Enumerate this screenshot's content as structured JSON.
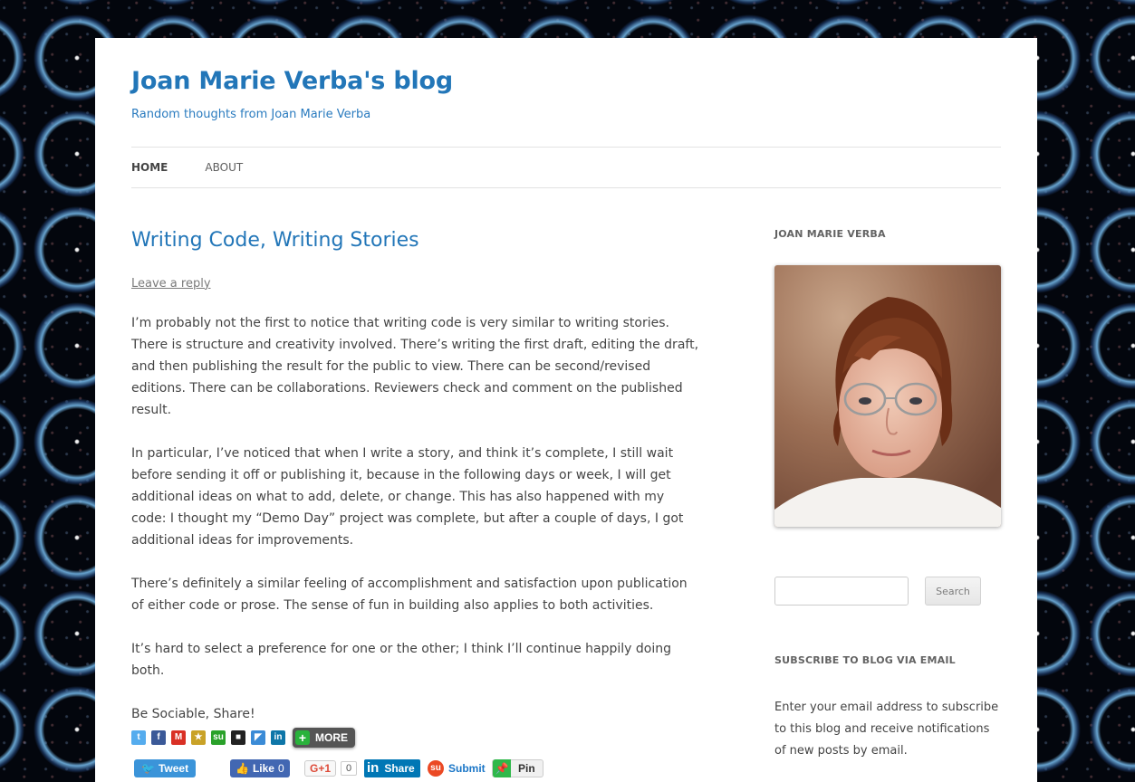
{
  "site": {
    "title": "Joan Marie Verba's blog",
    "tagline": "Random thoughts from Joan Marie Verba"
  },
  "nav": {
    "items": [
      {
        "label": "Home",
        "active": true
      },
      {
        "label": "About",
        "active": false
      }
    ]
  },
  "post": {
    "title": "Writing Code, Writing Stories",
    "leave_reply": "Leave a reply",
    "paragraphs": [
      "I’m probably not the first to notice that writing code is very similar to writing stories. There is structure and creativity involved. There’s writing the first draft, editing the draft, and then publishing the result for the public to view. There can be second/revised editions. There can be collaborations. Reviewers check and comment on the published result.",
      "In particular, I’ve noticed that when I write a story, and think it’s complete, I still wait before sending it off or publishing it, because in the following days or week, I will get additional ideas on what to add, delete, or change. This has also happened with my code: I thought my “Demo Day” project was complete, but after a couple of days, I got additional ideas for improvements.",
      "There’s definitely a similar feeling of accomplishment and satisfaction upon publication of either code or prose. The sense of fun in building also applies to both activities.",
      "It’s hard to select a preference for one or the other; I think I’ll continue happily doing both."
    ]
  },
  "share": {
    "label": "Be Sociable, Share!",
    "icons": [
      {
        "name": "twitter-icon",
        "color": "#55acee",
        "glyph": "t"
      },
      {
        "name": "facebook-icon",
        "color": "#3b5998",
        "glyph": "f"
      },
      {
        "name": "gmail-icon",
        "color": "#d93025",
        "glyph": "M"
      },
      {
        "name": "favorites-star-icon",
        "color": "#c9a227",
        "glyph": "★"
      },
      {
        "name": "stumbleupon-icon",
        "color": "#2aa12a",
        "glyph": "su"
      },
      {
        "name": "delicious-icon",
        "color": "#222222",
        "glyph": "■"
      },
      {
        "name": "google-bookmarks-icon",
        "color": "#3b8bd6",
        "glyph": "◤"
      },
      {
        "name": "linkedin-icon",
        "color": "#0e76a8",
        "glyph": "in"
      }
    ],
    "more_label": "MORE",
    "buttons": {
      "tweet": "Tweet",
      "like": "Like",
      "like_count": "0",
      "gplus": "G+1",
      "gplus_count": "0",
      "linkedin_share": "Share",
      "stumble_submit": "Submit",
      "pin": "Pin"
    }
  },
  "sidebar": {
    "author_title": "Joan Marie Verba",
    "search": {
      "placeholder": "",
      "value": "",
      "button": "Search"
    },
    "subscribe_title": "Subscribe to Blog via Email",
    "subscribe_text": "Enter your email address to subscribe to this blog and receive notifications of new posts by email."
  },
  "colors": {
    "link": "#2276b8",
    "text": "#444444",
    "background": "#03060d"
  }
}
